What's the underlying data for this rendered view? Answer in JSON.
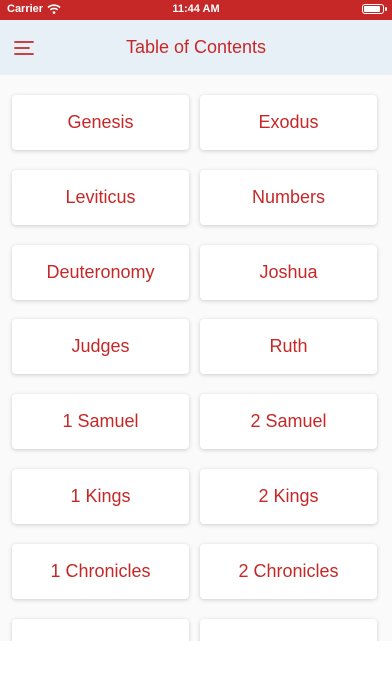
{
  "status": {
    "carrier": "Carrier",
    "time": "11:44 AM",
    "battery_level": 0.95,
    "background": "#c62828"
  },
  "nav": {
    "title": "Table of Contents",
    "menu_icon": "menu-icon",
    "accent": "#c62828",
    "background": "#e8f0f7"
  },
  "books": [
    "Genesis",
    "Exodus",
    "Leviticus",
    "Numbers",
    "Deuteronomy",
    "Joshua",
    "Judges",
    "Ruth",
    "1 Samuel",
    "2 Samuel",
    "1 Kings",
    "2 Kings",
    "1 Chronicles",
    "2 Chronicles",
    "",
    ""
  ]
}
